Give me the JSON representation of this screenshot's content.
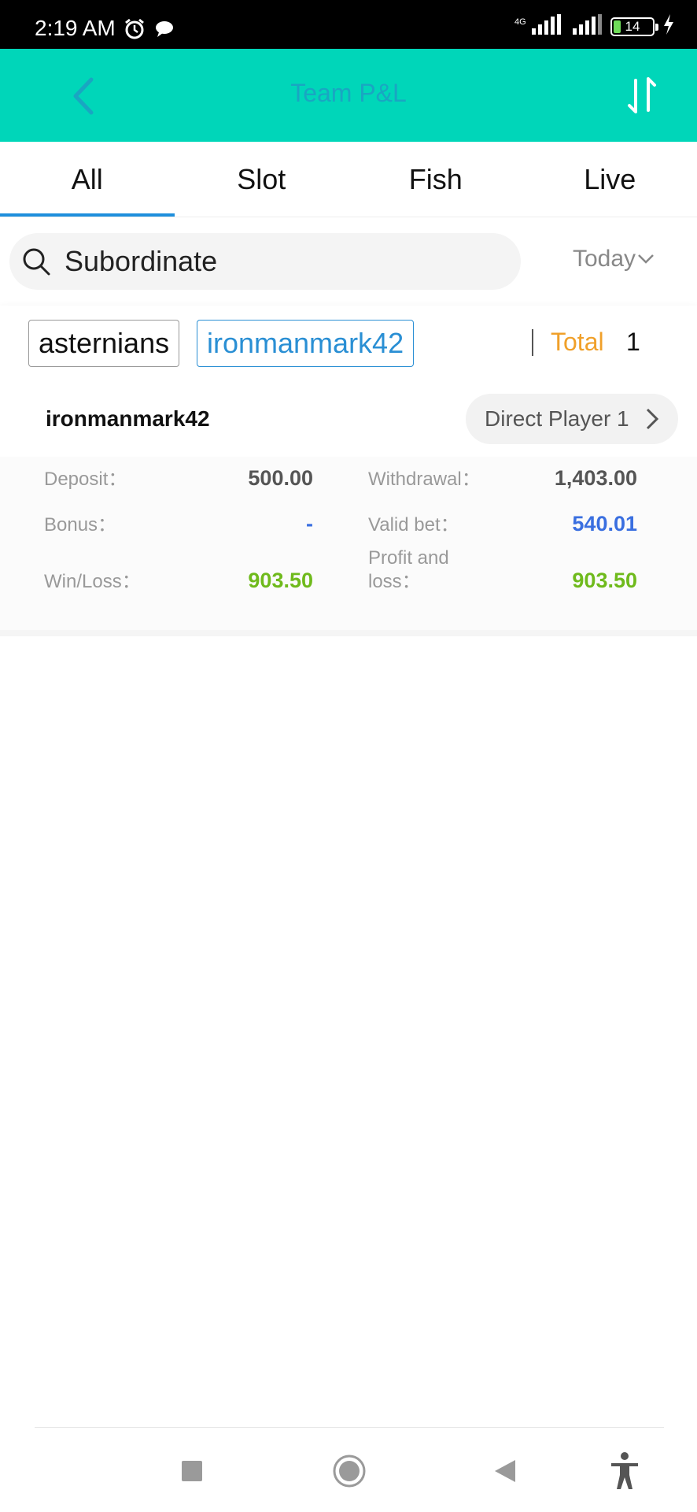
{
  "status_bar": {
    "time": "2:19 AM",
    "network_type": "4G",
    "battery_level": "14"
  },
  "header": {
    "title": "Team P&L",
    "back_icon": "chevron-left-icon",
    "sort_icon": "sort-arrows-icon"
  },
  "tabs": [
    {
      "label": "All",
      "active": true
    },
    {
      "label": "Slot",
      "active": false
    },
    {
      "label": "Fish",
      "active": false
    },
    {
      "label": "Live",
      "active": false
    }
  ],
  "search": {
    "placeholder": "Subordinate",
    "value": ""
  },
  "date_filter": {
    "selected": "Today"
  },
  "breadcrumb": {
    "items": [
      "asternians",
      "ironmanmark42"
    ],
    "total_label": "Total",
    "total_value": "1"
  },
  "player": {
    "name": "ironmanmark42",
    "direct_label": "Direct Player 1",
    "deposit_label": "Deposit：",
    "deposit_value": "500.00",
    "withdrawal_label": "Withdrawal：",
    "withdrawal_value": "1,403.00",
    "bonus_label": "Bonus：",
    "bonus_value": "-",
    "valid_bet_label": "Valid bet：",
    "valid_bet_value": "540.01",
    "winloss_label": "Win/Loss：",
    "winloss_value": "903.50",
    "pnl_label_line1": "Profit and",
    "pnl_label_line2": "loss：",
    "pnl_value": "903.50"
  },
  "colors": {
    "header_bg": "#00d6b9",
    "tab_active": "#1e8fdc",
    "total_label": "#f0a02a",
    "positive_green": "#6fba1c",
    "bet_blue": "#3a6fe0"
  },
  "nav_bar": {
    "icons": [
      "square-recents-icon",
      "circle-home-icon",
      "triangle-back-icon",
      "accessibility-icon"
    ]
  }
}
